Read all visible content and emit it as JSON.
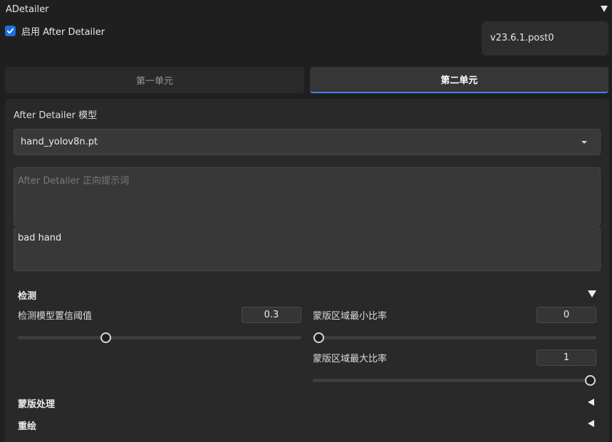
{
  "header": {
    "title": "ADetailer",
    "enable_label": "启用 After Detailer",
    "enabled": true,
    "version": "v23.6.1.post0"
  },
  "tabs": [
    {
      "label": "第一单元",
      "active": false
    },
    {
      "label": "第二单元",
      "active": true
    }
  ],
  "model": {
    "label": "After Detailer 模型",
    "selected": "hand_yolov8n.pt"
  },
  "prompt": {
    "placeholder": "After Detailer 正向提示词",
    "value": ""
  },
  "negative_prompt": {
    "value": "bad hand"
  },
  "detection": {
    "title": "检测",
    "confidence": {
      "label": "检测模型置信阈值",
      "value": "0.3",
      "fraction": 0.3
    },
    "mask_min": {
      "label": "蒙版区域最小比率",
      "value": "0",
      "fraction": 0.0
    },
    "mask_max": {
      "label": "蒙版区域最大比率",
      "value": "1",
      "fraction": 1.0
    }
  },
  "sections": {
    "mask_processing": "蒙版处理",
    "inpainting": "重绘"
  },
  "colors": {
    "accent": "#1e6fe0",
    "tab_underline": "#3b82f6",
    "background": "#1f1f1f",
    "panel": "#292929"
  }
}
